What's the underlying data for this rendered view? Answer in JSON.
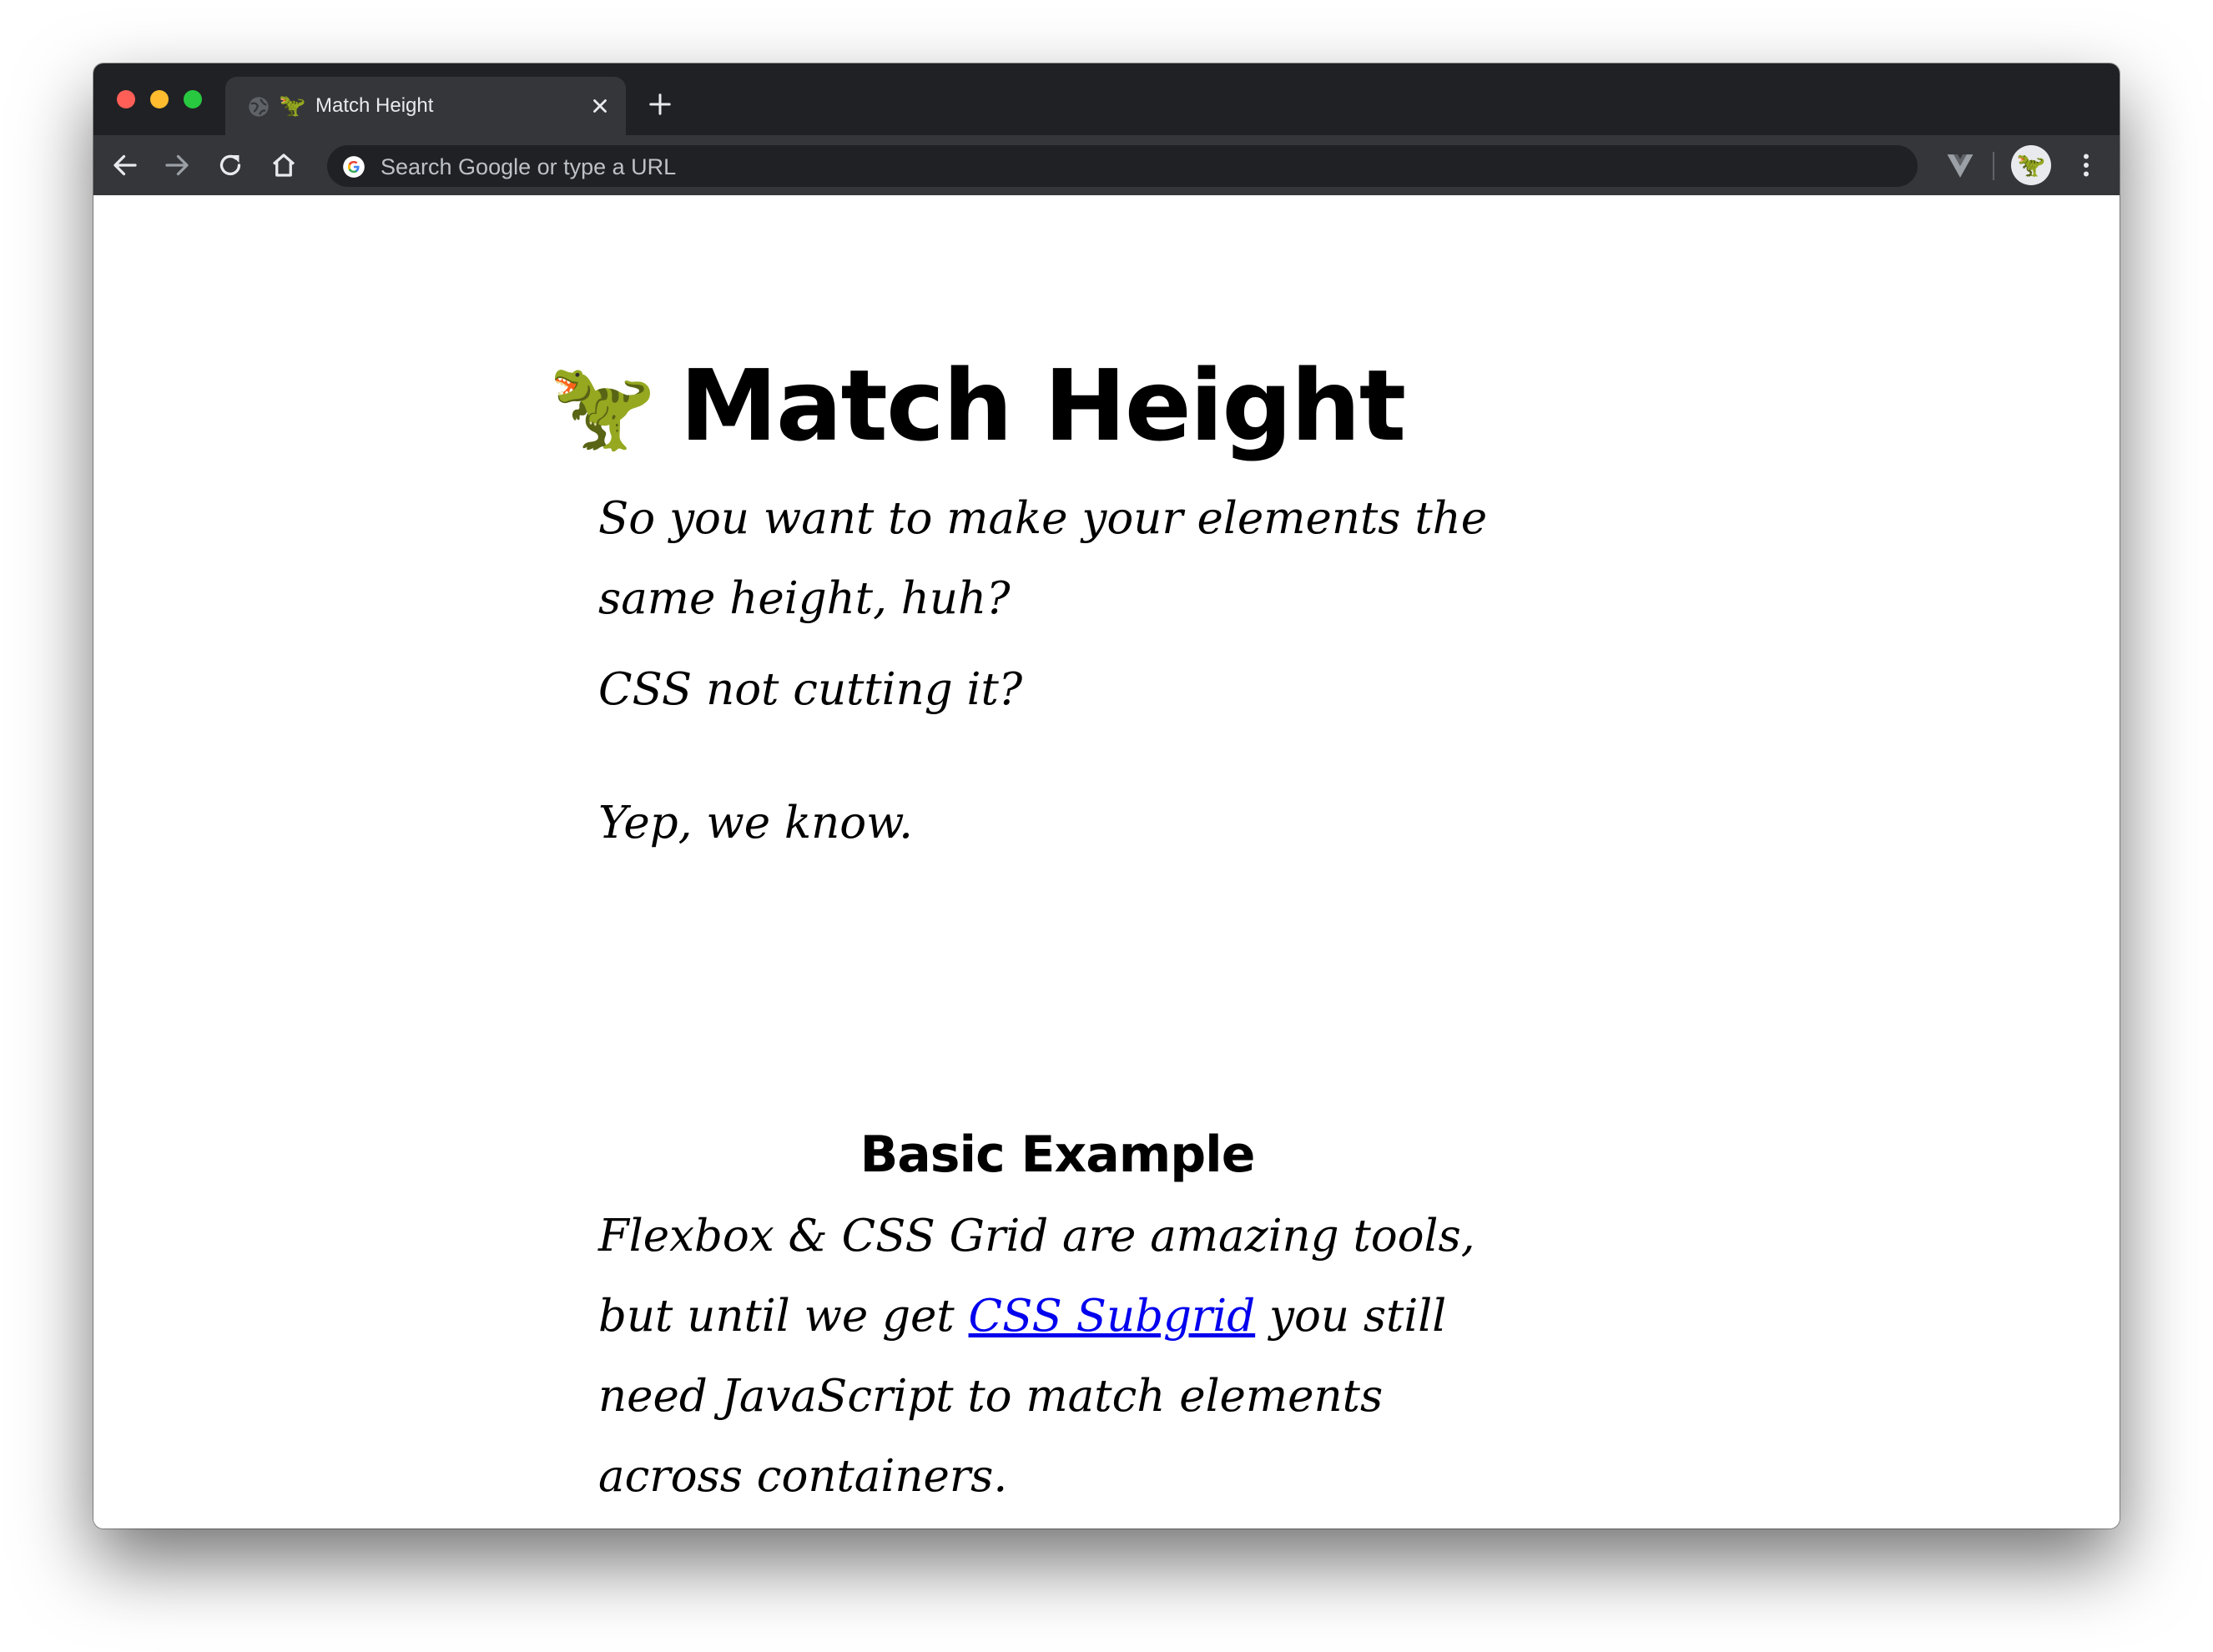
{
  "browser": {
    "tab": {
      "title": "Match Height",
      "favicon": "🦖"
    },
    "omnibox": {
      "placeholder": "Search Google or type a URL",
      "value": ""
    },
    "avatar": "🦖"
  },
  "page": {
    "heading": {
      "emoji": "🦖",
      "text": "Match Height"
    },
    "intro": [
      "So you want to make your elements the same height, huh?",
      "CSS not cutting it?",
      "Yep, we know."
    ],
    "section": {
      "title": "Basic Example",
      "paragraph": {
        "before": "Flexbox & CSS Grid are amazing tools, but until we get ",
        "link": "CSS Subgrid",
        "after": " you still need JavaScript to match elements across containers."
      }
    }
  }
}
